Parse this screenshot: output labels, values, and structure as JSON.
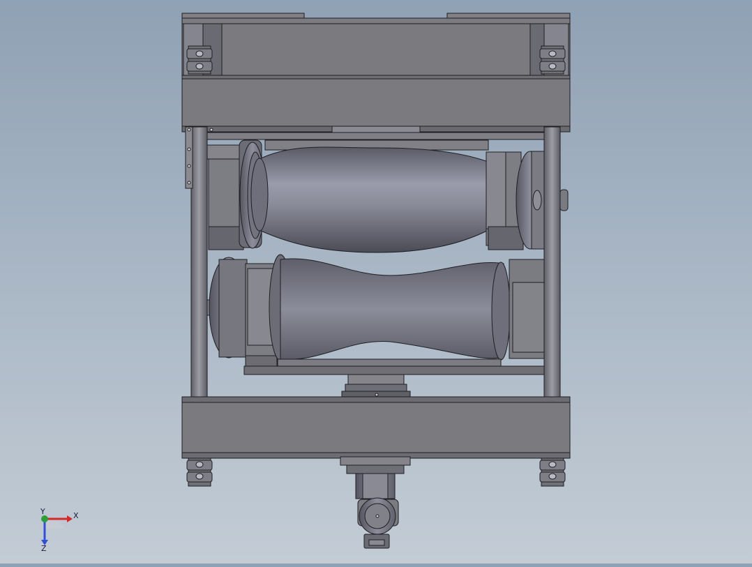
{
  "viewport": {
    "model": "roller-stand-assembly",
    "background_top": "#8fa1b4",
    "background_bottom": "#c3ccd5",
    "frame_color": "#77777b",
    "roller_color": "#7b7c87"
  },
  "triad": {
    "x_label": "X",
    "y_label": "Y",
    "z_label": "Z",
    "x_color": "#d62828",
    "y_color": "#2e9e3a",
    "z_color": "#2e4fd6"
  }
}
